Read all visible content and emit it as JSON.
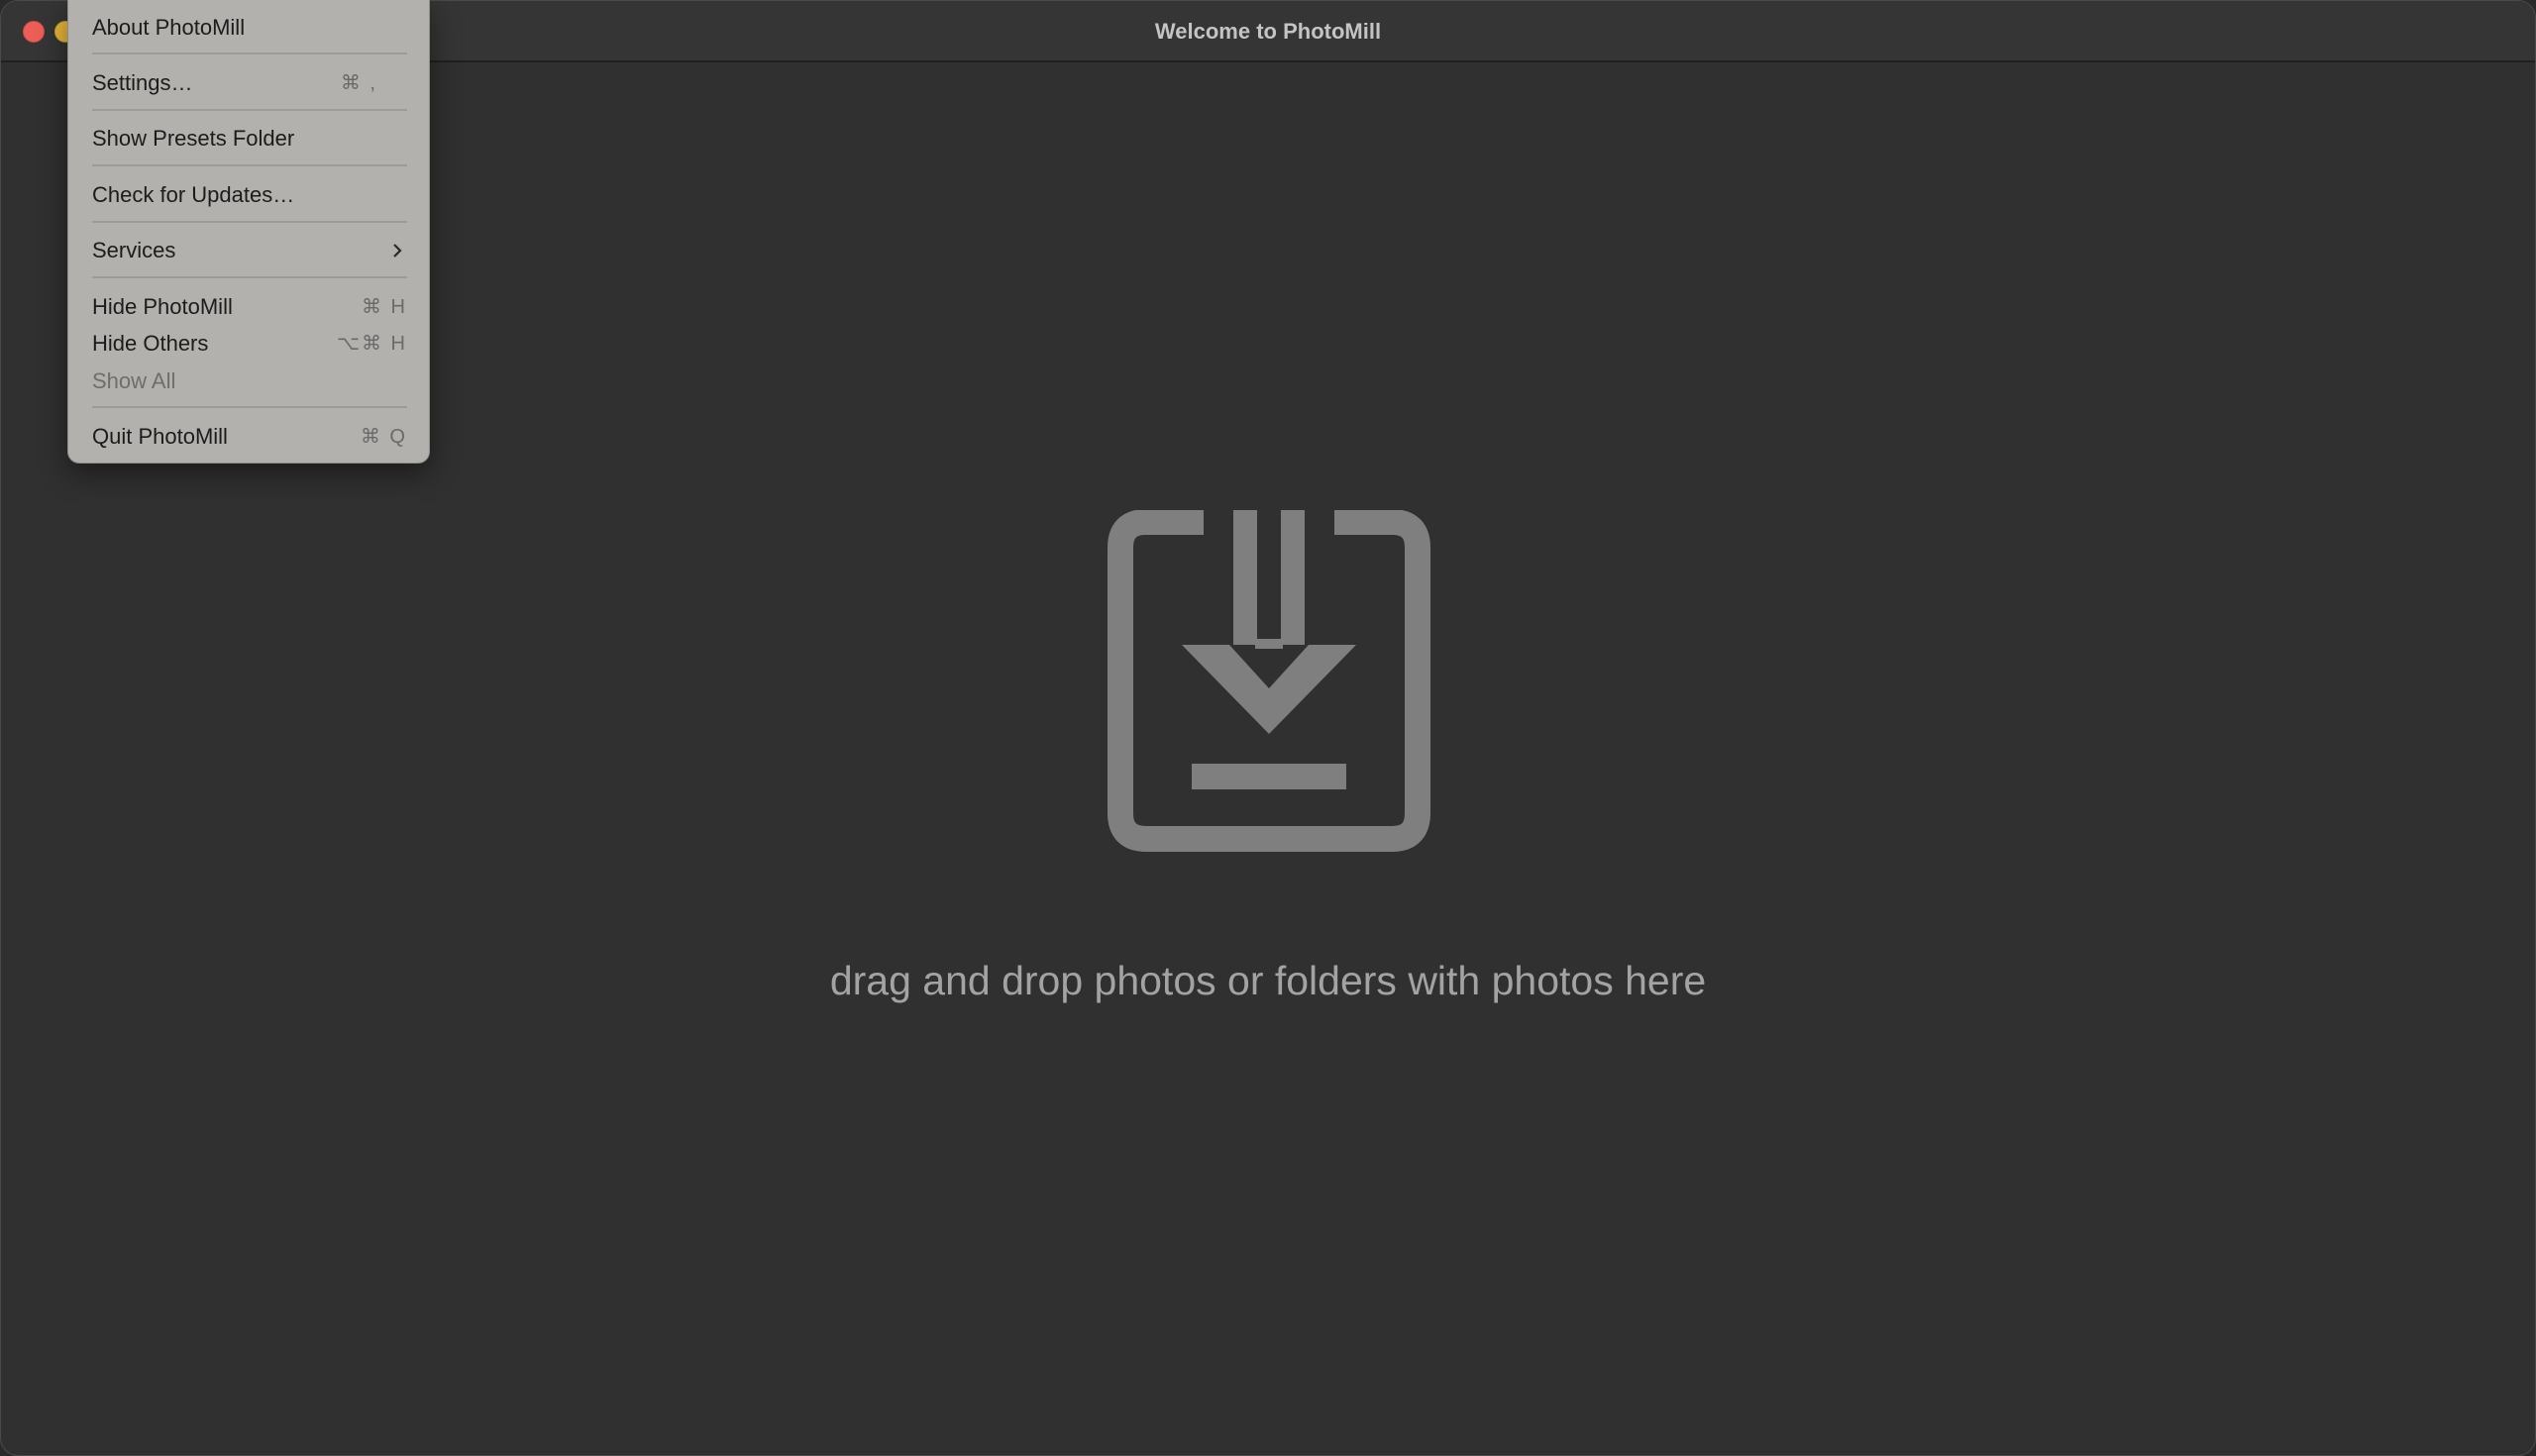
{
  "window": {
    "title": "Welcome to PhotoMill"
  },
  "main": {
    "drop_message": "drag and drop photos or folders with photos here",
    "drop_icon": "download-into-tray-icon"
  },
  "app_menu": {
    "about": "About PhotoMill",
    "settings": "Settings…",
    "settings_shortcut": "⌘ ,",
    "show_presets": "Show Presets Folder",
    "check_updates": "Check for Updates…",
    "services": "Services",
    "hide_app": "Hide PhotoMill",
    "hide_app_shortcut": "⌘ H",
    "hide_others": "Hide Others",
    "hide_others_shortcut": "⌥⌘ H",
    "show_all": "Show All",
    "quit": "Quit PhotoMill",
    "quit_shortcut": "⌘ Q"
  },
  "colors": {
    "close": "#ec5f57",
    "minimize": "#e9b83c",
    "background": "#303030",
    "icon": "#7f7f7f"
  }
}
